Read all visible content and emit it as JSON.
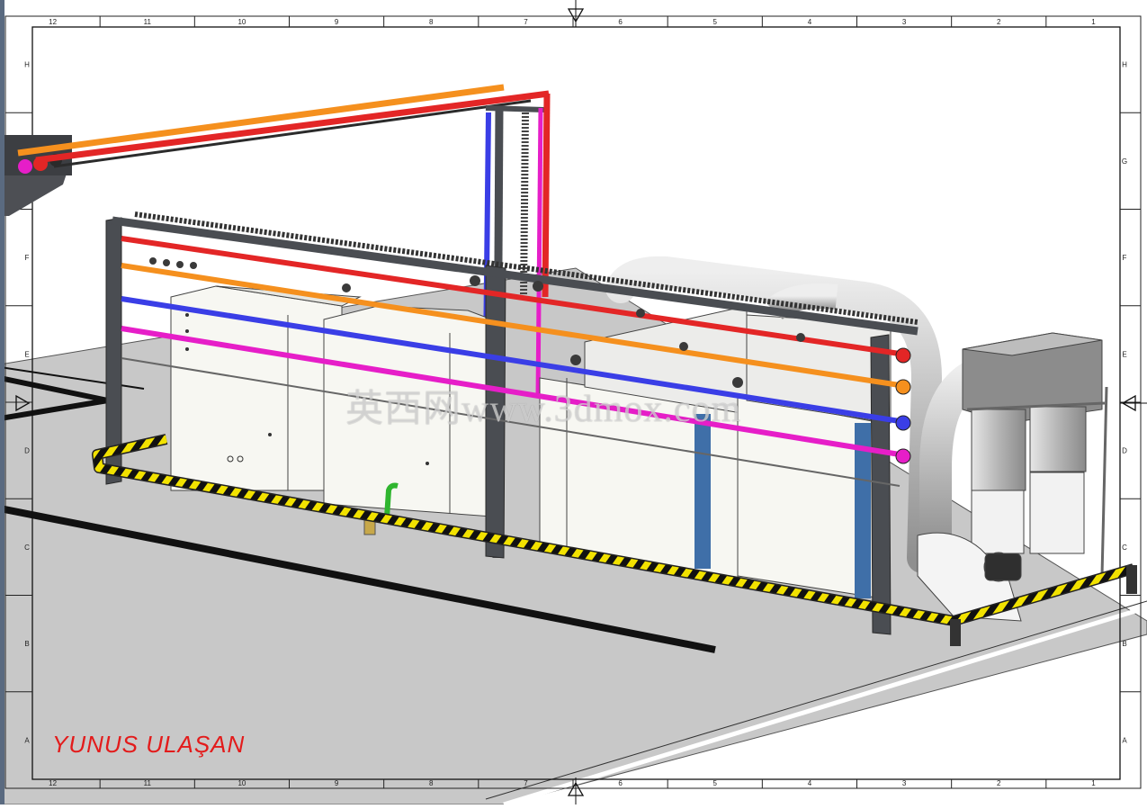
{
  "drawing": {
    "author": "YUNUS ULAŞAN",
    "watermark": "英西网www.3dmox.com",
    "columns": [
      "12",
      "11",
      "10",
      "9",
      "8",
      "7",
      "6",
      "5",
      "4",
      "3",
      "2",
      "1"
    ],
    "rows": [
      "H",
      "G",
      "F",
      "E",
      "D",
      "C",
      "B",
      "A"
    ]
  },
  "colors": {
    "pipe_red": "#e32626",
    "pipe_orange": "#f5901e",
    "pipe_blue": "#3a3ee6",
    "pipe_magenta": "#e61ec8",
    "frame_steel": "#4a4d52",
    "hazard_yellow": "#f2e200",
    "floor": "#c9c9c9"
  },
  "icons": {
    "frame_marker": "triangle-marker-icon"
  }
}
